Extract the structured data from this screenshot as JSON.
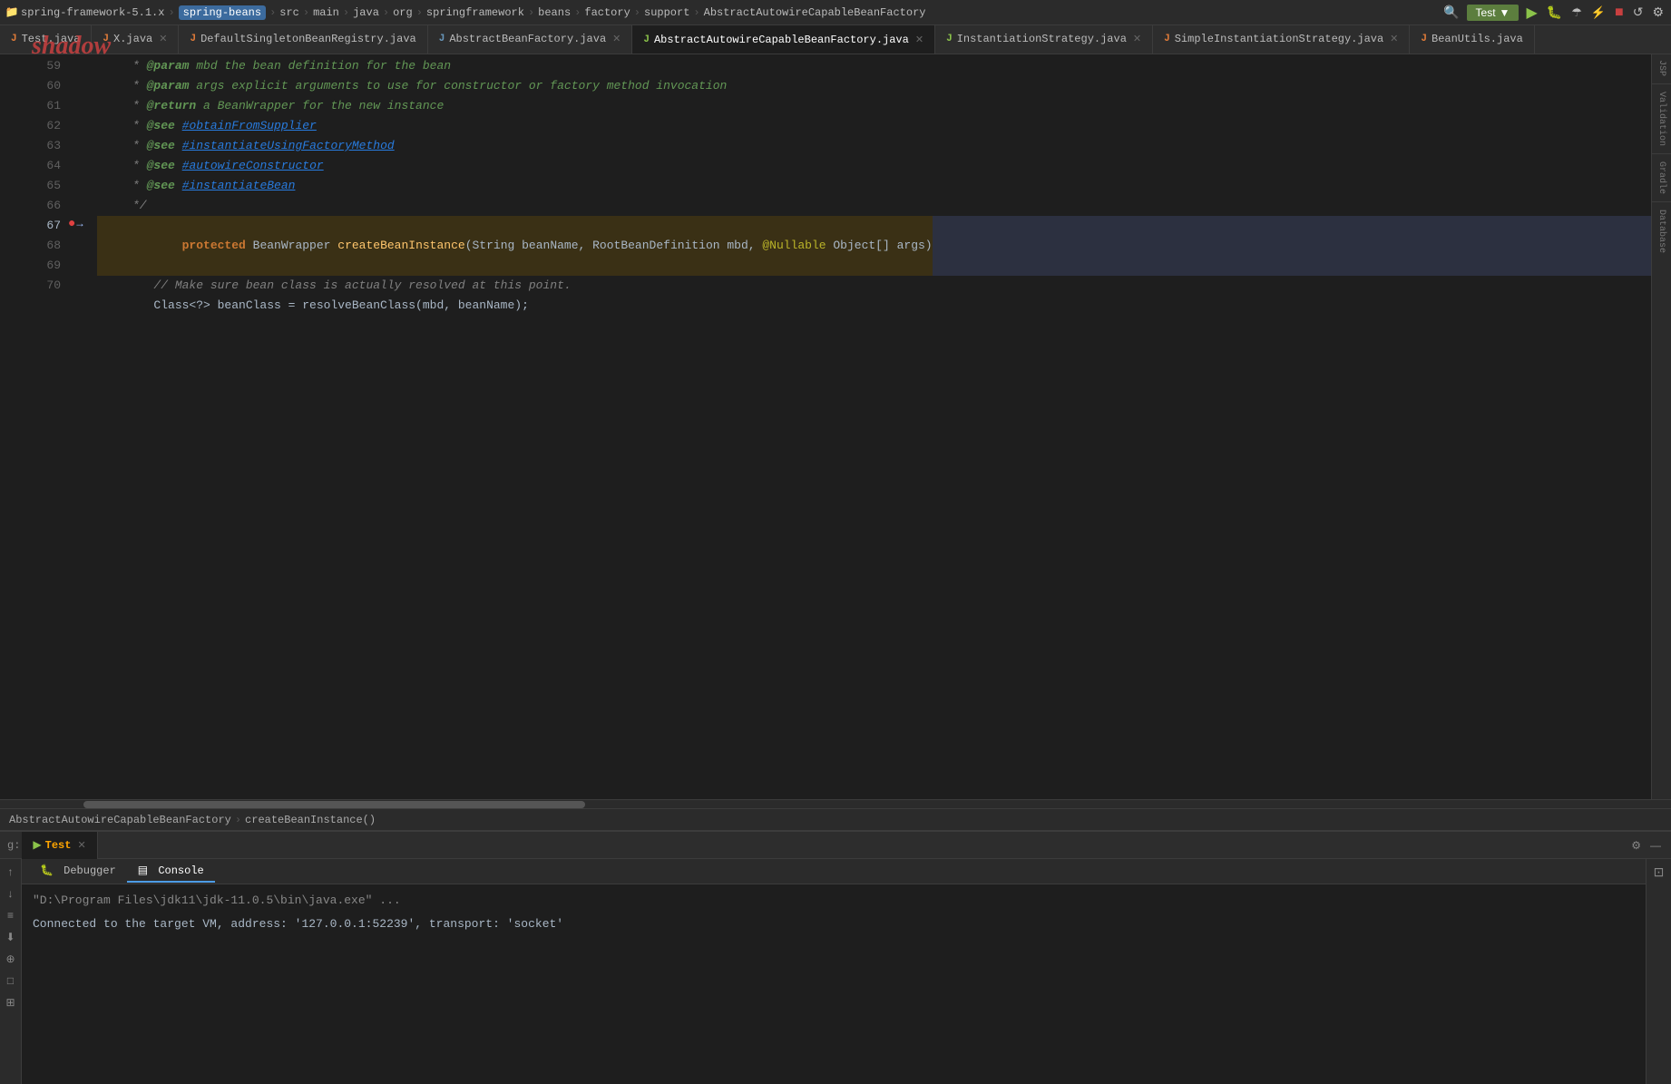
{
  "topNav": {
    "items": [
      {
        "id": "framework",
        "label": "spring-framework-5.1.x",
        "icon": "folder"
      },
      {
        "id": "spring-beans",
        "label": "spring-beans",
        "icon": "folder",
        "highlighted": true
      },
      {
        "id": "src",
        "label": "src",
        "icon": "folder"
      },
      {
        "id": "main",
        "label": "main",
        "icon": "folder"
      },
      {
        "id": "java",
        "label": "java",
        "icon": "folder"
      },
      {
        "id": "org",
        "label": "org",
        "icon": "folder"
      },
      {
        "id": "springframework",
        "label": "springframework",
        "icon": "folder"
      },
      {
        "id": "beans",
        "label": "beans",
        "icon": "folder"
      },
      {
        "id": "factory",
        "label": "factory",
        "icon": "folder"
      },
      {
        "id": "support",
        "label": "support",
        "icon": "folder"
      },
      {
        "id": "class",
        "label": "AbstractAutowireCapableBeanFactory",
        "icon": "class"
      }
    ],
    "runConfig": "Test",
    "runBtn": "▶",
    "debugBtn": "🐛"
  },
  "fileTabs": [
    {
      "id": "test-java",
      "label": "Test.java",
      "type": "java-orange",
      "active": false
    },
    {
      "id": "x-java",
      "label": "X.java",
      "type": "java-orange",
      "active": false,
      "closeable": true
    },
    {
      "id": "default-singleton",
      "label": "DefaultSingletonBeanRegistry.java",
      "type": "java-orange",
      "active": false,
      "closeable": false
    },
    {
      "id": "abstract-bean-factory",
      "label": "AbstractBeanFactory.java",
      "type": "java-blue",
      "active": false,
      "closeable": true
    },
    {
      "id": "abstract-autowire",
      "label": "AbstractAutowireCapableBeanFactory.java",
      "type": "java-green",
      "active": true,
      "closeable": true
    },
    {
      "id": "instantiation-strategy",
      "label": "InstantiationStrategy.java",
      "type": "java-green",
      "active": false,
      "closeable": true
    },
    {
      "id": "simple-instantiation",
      "label": "SimpleInstantiationStrategy.java",
      "type": "java-orange",
      "active": false,
      "closeable": true
    },
    {
      "id": "bean-utils",
      "label": "BeanUtils.java",
      "type": "java-orange",
      "active": false,
      "closeable": false
    }
  ],
  "breadcrumb": {
    "items": [
      "AbstractAutowireCapableBeanFactory",
      "createBeanInstance()"
    ]
  },
  "codeLines": [
    {
      "num": 59,
      "gutter": "",
      "tokens": [
        {
          "text": "     * ",
          "cls": "comment"
        },
        {
          "text": "@param",
          "cls": "kw-at-param"
        },
        {
          "text": " mbd the bean definition for the bean",
          "cls": "comment-italic"
        }
      ]
    },
    {
      "num": 60,
      "gutter": "",
      "tokens": [
        {
          "text": "     * ",
          "cls": "comment"
        },
        {
          "text": "@param",
          "cls": "kw-at-param"
        },
        {
          "text": " args explicit arguments to use for constructor or factory method invocation",
          "cls": "comment-italic"
        }
      ]
    },
    {
      "num": 61,
      "gutter": "",
      "tokens": [
        {
          "text": "     * ",
          "cls": "comment"
        },
        {
          "text": "@return",
          "cls": "kw-at-return"
        },
        {
          "text": " a BeanWrapper for the new instance",
          "cls": "comment-italic"
        }
      ]
    },
    {
      "num": 62,
      "gutter": "",
      "tokens": [
        {
          "text": "     * ",
          "cls": "comment"
        },
        {
          "text": "@see",
          "cls": "kw-at-see"
        },
        {
          "text": " ",
          "cls": "comment"
        },
        {
          "text": "#obtainFromSupplier",
          "cls": "comment-link"
        }
      ]
    },
    {
      "num": 63,
      "gutter": "",
      "tokens": [
        {
          "text": "     * ",
          "cls": "comment"
        },
        {
          "text": "@see",
          "cls": "kw-at-see"
        },
        {
          "text": " ",
          "cls": "comment"
        },
        {
          "text": "#instantiateUsingFactoryMethod",
          "cls": "comment-link"
        }
      ]
    },
    {
      "num": 64,
      "gutter": "",
      "tokens": [
        {
          "text": "     * ",
          "cls": "comment"
        },
        {
          "text": "@see",
          "cls": "kw-at-see"
        },
        {
          "text": " ",
          "cls": "comment"
        },
        {
          "text": "#autowireConstructor",
          "cls": "comment-link"
        }
      ]
    },
    {
      "num": 65,
      "gutter": "",
      "tokens": [
        {
          "text": "     * ",
          "cls": "comment"
        },
        {
          "text": "@see",
          "cls": "kw-at-see"
        },
        {
          "text": " ",
          "cls": "comment"
        },
        {
          "text": "#instantiateBean",
          "cls": "comment-link"
        }
      ]
    },
    {
      "num": 66,
      "gutter": "",
      "tokens": [
        {
          "text": "     */",
          "cls": "comment"
        }
      ]
    },
    {
      "num": 67,
      "gutter": "run+breakpoint",
      "highlighted": true,
      "tokens": [
        {
          "text": "protected",
          "cls": "kw-protected"
        },
        {
          "text": " BeanWrapper ",
          "cls": "plain"
        },
        {
          "text": "createBeanInstance",
          "cls": "method-name"
        },
        {
          "text": "(String beanName, RootBeanDefinition mbd, ",
          "cls": "plain"
        },
        {
          "text": "@Nullable",
          "cls": "nullable"
        },
        {
          "text": " Object[] args)",
          "cls": "plain"
        }
      ]
    },
    {
      "num": 68,
      "gutter": "",
      "tokens": [
        {
          "text": "        // Make sure bean class is actually resolved at this point.",
          "cls": "comment"
        }
      ]
    },
    {
      "num": 69,
      "gutter": "",
      "tokens": [
        {
          "text": "        Class<?> beanClass = resolveBeanClass(mbd, beanName);",
          "cls": "plain"
        }
      ]
    },
    {
      "num": 70,
      "gutter": "",
      "tokens": []
    }
  ],
  "bottomPanel": {
    "runningTab": {
      "prefix": "g:",
      "icon": "▶",
      "label": "Test",
      "closeable": true
    },
    "settingsIcon": "⚙",
    "minimizeIcon": "—",
    "debuggerTab": "Debugger",
    "consoleTab": "Console",
    "consoleLines": [
      {
        "text": "\"D:\\Program Files\\jdk11\\jdk-11.0.5\\bin\\java.exe\" ...",
        "cls": "gray"
      },
      {
        "text": "Connected to the target VM, address: '127.0.0.1:52239', transport: 'socket'",
        "cls": "normal"
      }
    ],
    "sideTools": [
      "↑",
      "↓",
      "≡",
      "⬇",
      "⊕",
      "□",
      "⊞"
    ]
  },
  "rightSidebar": {
    "panels": [
      "JSP",
      "Validation",
      "Gradle",
      "Database"
    ]
  },
  "shadowLogo": "shadow"
}
